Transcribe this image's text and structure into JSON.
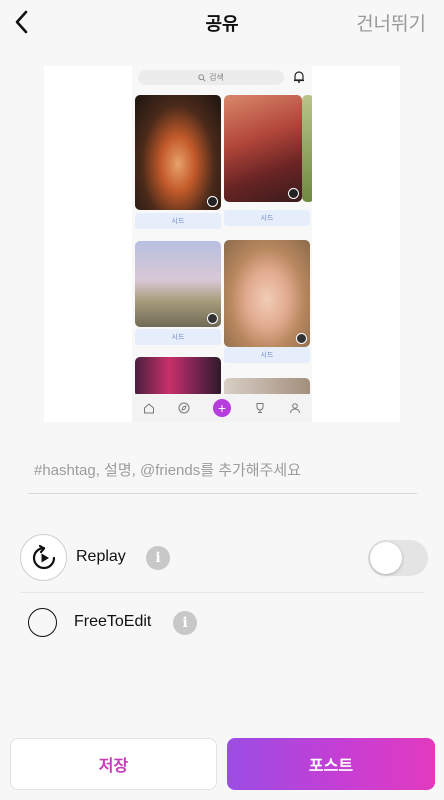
{
  "header": {
    "title": "공유",
    "skip_label": "건너뛰기",
    "back_icon": "chevron-left-icon"
  },
  "preview": {
    "search_placeholder": "검색",
    "seed_label": "시드",
    "icons": [
      "search-icon",
      "bell-icon",
      "home-icon",
      "compass-icon",
      "plus-icon",
      "trophy-icon",
      "profile-icon"
    ]
  },
  "caption": {
    "placeholder": "#hashtag, 설명, @friends를 추가해주세요",
    "value": ""
  },
  "options": {
    "replay_label": "Replay",
    "replay_enabled": false,
    "freetoedit_label": "FreeToEdit",
    "freetoedit_checked": false,
    "info_glyph": "i"
  },
  "actions": {
    "save_label": "저장",
    "post_label": "포스트"
  },
  "colors": {
    "accent_start": "#9b4de4",
    "accent_end": "#e23bbf",
    "save_text": "#c63bb8"
  }
}
